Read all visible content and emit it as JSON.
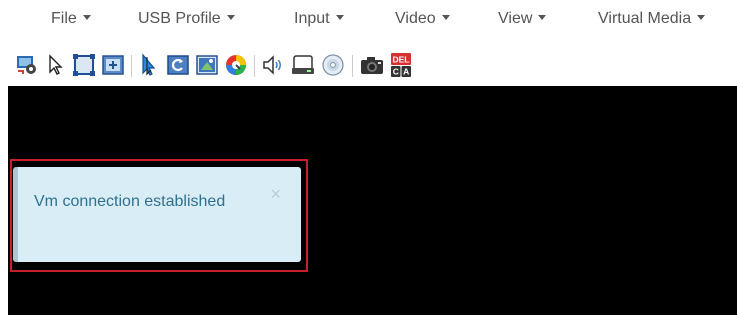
{
  "menu": [
    {
      "label": "File"
    },
    {
      "label": "USB Profile"
    },
    {
      "label": "Input"
    },
    {
      "label": "Video"
    },
    {
      "label": "View"
    },
    {
      "label": "Virtual Media"
    }
  ],
  "toolbar_icons": [
    "settings-screen-icon",
    "pointer-icon",
    "fullscreen-icon",
    "fit-screen-icon",
    "mouse-pointer-icon",
    "refresh-icon",
    "image-adjust-icon",
    "color-wheel-icon",
    "speaker-icon",
    "drive-icon",
    "cd-icon",
    "camera-icon",
    "ctrl-alt-del-icon"
  ],
  "ctrl_alt_del": {
    "top": "DEL",
    "left": "C",
    "right": "A"
  },
  "alert": {
    "message": "Vm connection established",
    "close": "×"
  },
  "colors": {
    "alert_bg": "#d9edf7",
    "alert_text": "#31708f",
    "frame": "#c8202a",
    "viewport": "#000000"
  }
}
